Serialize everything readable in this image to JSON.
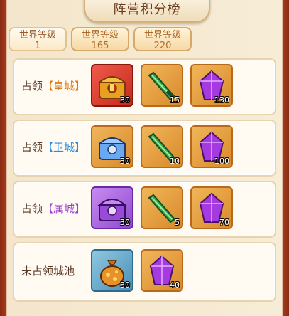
{
  "title": "阵营积分榜",
  "tabs": [
    {
      "label": "世界等级",
      "level": "1",
      "active": true
    },
    {
      "label": "世界等级",
      "level": "165",
      "active": false
    },
    {
      "label": "世界等级",
      "level": "220",
      "active": false
    }
  ],
  "rows": [
    {
      "prefix": "占领",
      "bracket": "【皇城】",
      "rewards": [
        {
          "icon": "gold-chest-icon",
          "qty": "30"
        },
        {
          "icon": "jade-blade-icon",
          "qty": "15"
        },
        {
          "icon": "purple-crystal-icon",
          "qty": "130"
        }
      ]
    },
    {
      "prefix": "占领",
      "bracket": "【卫城】",
      "rewards": [
        {
          "icon": "silver-chest-icon",
          "qty": "30"
        },
        {
          "icon": "jade-blade-icon",
          "qty": "10"
        },
        {
          "icon": "purple-crystal-icon",
          "qty": "100"
        }
      ]
    },
    {
      "prefix": "占领",
      "bracket": "【属城】",
      "rewards": [
        {
          "icon": "purple-chest-icon",
          "qty": "30"
        },
        {
          "icon": "jade-blade-icon",
          "qty": "5"
        },
        {
          "icon": "purple-crystal-icon",
          "qty": "70"
        }
      ]
    },
    {
      "label": "未占领城池",
      "rewards": [
        {
          "icon": "coin-bag-icon",
          "qty": "30"
        },
        {
          "icon": "purple-crystal-icon",
          "qty": "40"
        }
      ]
    }
  ],
  "colors": {
    "accent_gold": "#e07a12",
    "accent_blue": "#2a8ce0",
    "accent_purple": "#9a3fd0"
  }
}
